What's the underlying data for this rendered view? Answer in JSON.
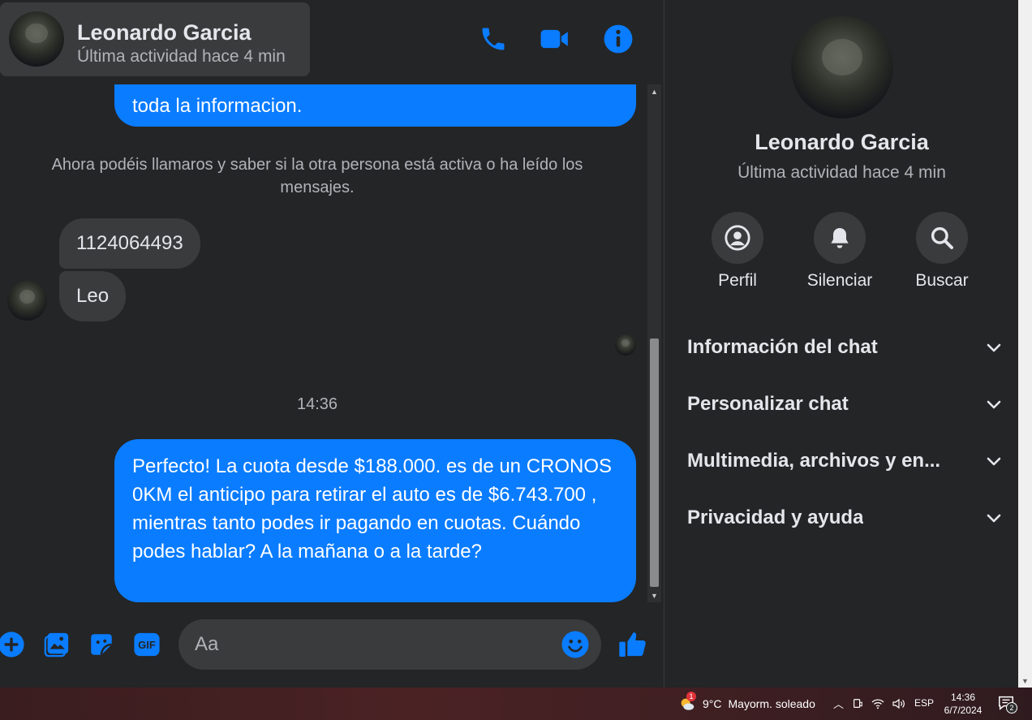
{
  "header": {
    "name": "Leonardo Garcia",
    "status": "Última actividad hace 4 min",
    "call_icon": "phone-icon",
    "video_icon": "video-camera-icon",
    "info_icon": "info-icon"
  },
  "messages": {
    "partial_outgoing": "toda la informacion.",
    "system_note": "Ahora podéis llamaros y saber si la otra persona está activa o ha leído los mensajes.",
    "incoming": [
      "1124064493",
      "Leo"
    ],
    "time_separator": "14:36",
    "outgoing_main": "Perfecto! La cuota desde $188.000. es de un CRONOS 0KM el anticipo para retirar el auto es de $6.743.700 , mientras tanto podes ir pagando en cuotas. Cuándo podes hablar? A la mañana o a la tarde?"
  },
  "composer": {
    "placeholder": "Aa",
    "gif_label": "GIF"
  },
  "panel": {
    "name": "Leonardo Garcia",
    "status": "Última actividad hace 4 min",
    "actions": [
      {
        "label": "Perfil",
        "icon": "profile-icon"
      },
      {
        "label": "Silenciar",
        "icon": "bell-icon"
      },
      {
        "label": "Buscar",
        "icon": "search-icon"
      }
    ],
    "sections": [
      "Información del chat",
      "Personalizar chat",
      "Multimedia, archivos y en...",
      "Privacidad y ayuda"
    ]
  },
  "taskbar": {
    "temperature": "9°C",
    "weather": "Mayorm. soleado",
    "weather_badge": "1",
    "language": "ESP",
    "time": "14:36",
    "date": "6/7/2024",
    "notification_count": "2"
  },
  "colors": {
    "accent": "#0a7cff",
    "background": "#242526",
    "bubble_in": "#3a3b3c"
  }
}
